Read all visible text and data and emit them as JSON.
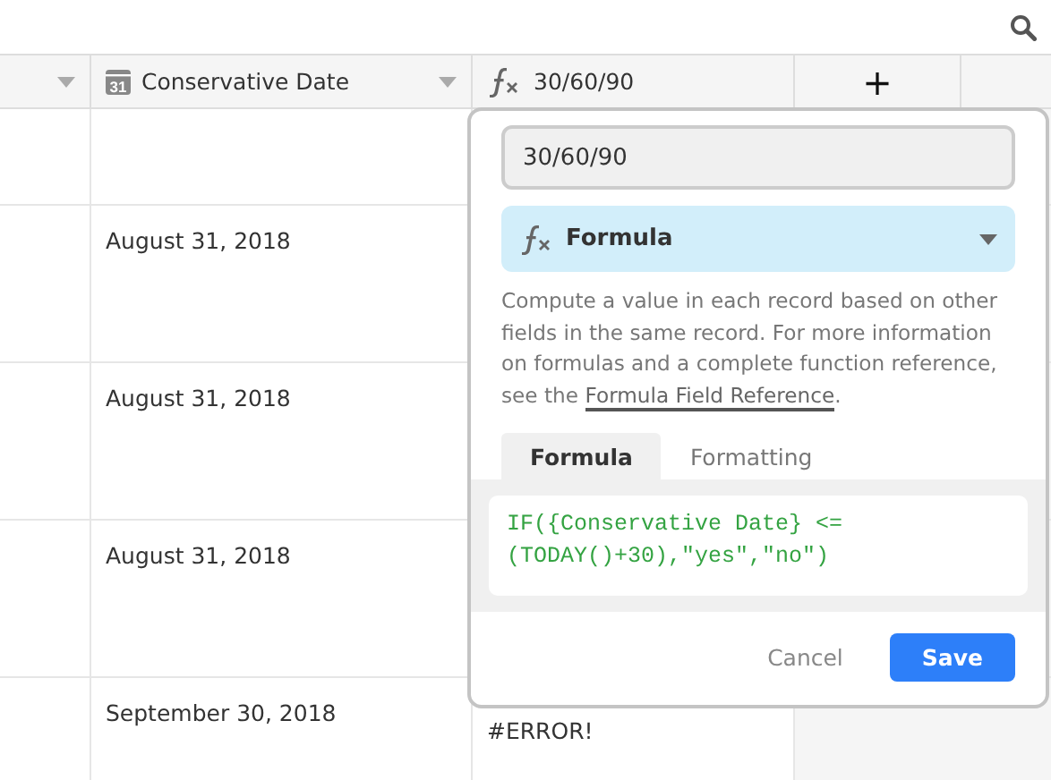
{
  "columns": [
    {
      "kind": "plain"
    },
    {
      "kind": "date",
      "label": "Conservative Date",
      "icon_text": "31"
    },
    {
      "kind": "formula",
      "label": "30/60/90"
    },
    {
      "kind": "add",
      "label": "+"
    }
  ],
  "rows": [
    {
      "date": "",
      "formula": ""
    },
    {
      "date": "August 31, 2018",
      "formula": ""
    },
    {
      "date": "August 31, 2018",
      "formula": ""
    },
    {
      "date": "August 31, 2018",
      "formula": ""
    },
    {
      "date": "September 30, 2018",
      "formula": "#ERROR!"
    }
  ],
  "popover": {
    "field_name": "30/60/90",
    "field_type": "Formula",
    "description": "Compute a value in each record based on other fields in the same record. For more information on formulas and a complete function reference, see the ",
    "link": "Formula Field Reference",
    "description_end": ".",
    "tabs": [
      {
        "label": "Formula",
        "selected": true
      },
      {
        "label": "Formatting",
        "selected": false
      }
    ],
    "formula": "IF({Conservative Date} <= (TODAY()+30),\"yes\",\"no\")",
    "buttons": [
      {
        "kind": "secondary",
        "label": "Cancel"
      },
      {
        "kind": "primary",
        "label": "Save"
      }
    ]
  }
}
